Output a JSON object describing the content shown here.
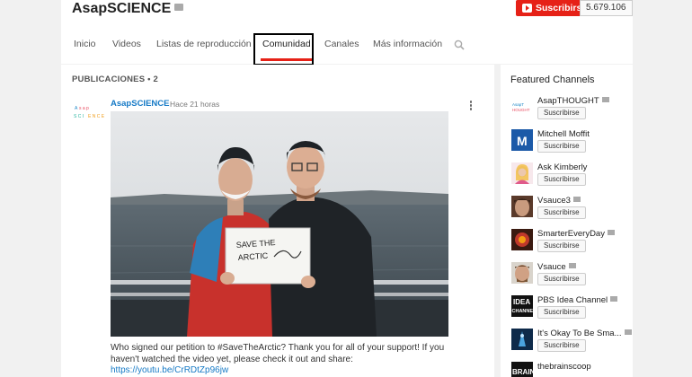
{
  "channel": {
    "title": "AsapSCIENCE",
    "subscribe_label": "Suscribirse",
    "subscriber_count": "5.679.106"
  },
  "tabs": [
    {
      "label": "Inicio"
    },
    {
      "label": "Videos"
    },
    {
      "label": "Listas de reproducción"
    },
    {
      "label": "Comunidad"
    },
    {
      "label": "Canales"
    },
    {
      "label": "Más información"
    }
  ],
  "active_tab": "Comunidad",
  "posts_header": "PUBLICACIONES • 2",
  "post": {
    "author": "AsapSCIENCE",
    "time": "Hace 21 horas",
    "sign_text": "SAVE THE ARCTIC",
    "text": "Who signed our petition to #SaveTheArctic? Thank you for all of your support! If you haven't watched the video yet, please check it out and share:",
    "link": "https://youtu.be/CrRDtZp96jw"
  },
  "featured": {
    "title": "Featured Channels",
    "subscribe_label": "Suscribirse",
    "channels": [
      {
        "name": "AsapTHOUGHT",
        "verified": true
      },
      {
        "name": "Mitchell Moffit",
        "verified": false
      },
      {
        "name": "Ask Kimberly",
        "verified": false
      },
      {
        "name": "Vsauce3",
        "verified": true
      },
      {
        "name": "SmarterEveryDay",
        "verified": true
      },
      {
        "name": "Vsauce",
        "verified": true
      },
      {
        "name": "PBS Idea Channel",
        "verified": true
      },
      {
        "name": "It's Okay To Be Sma...",
        "verified": true
      },
      {
        "name": "thebrainscoop",
        "verified": false
      }
    ]
  },
  "colors": {
    "brand_red": "#e62117",
    "link_blue": "#167ac6"
  }
}
